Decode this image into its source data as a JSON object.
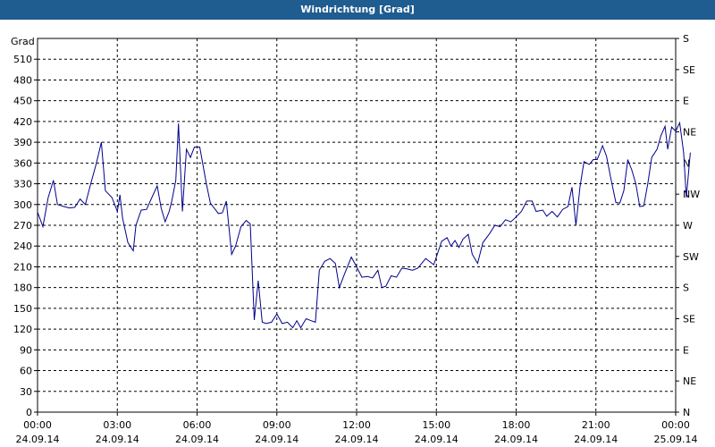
{
  "window": {
    "title": "Windrichtung [Grad]"
  },
  "chart_data": {
    "type": "line",
    "title": "Windrichtung [Grad]",
    "ylabel": "Grad",
    "xlabel": "",
    "ylim": [
      0,
      540
    ],
    "xlim_hours": [
      0,
      24
    ],
    "grid": true,
    "y_ticks": [
      0,
      30,
      60,
      90,
      120,
      150,
      180,
      210,
      240,
      270,
      300,
      330,
      360,
      390,
      420,
      450,
      480,
      510
    ],
    "y2_ticks": [
      {
        "value": 0,
        "label": "N"
      },
      {
        "value": 45,
        "label": "NE"
      },
      {
        "value": 90,
        "label": "E"
      },
      {
        "value": 135,
        "label": "SE"
      },
      {
        "value": 180,
        "label": "S"
      },
      {
        "value": 225,
        "label": "SW"
      },
      {
        "value": 270,
        "label": "W"
      },
      {
        "value": 315,
        "label": "NW"
      },
      {
        "value": 360,
        "label": "N"
      },
      {
        "value": 405,
        "label": "NE"
      },
      {
        "value": 450,
        "label": "E"
      },
      {
        "value": 495,
        "label": "SE"
      },
      {
        "value": 540,
        "label": "S"
      }
    ],
    "x_ticks": [
      {
        "hour": 0,
        "time": "00:00",
        "date": "24.09.14"
      },
      {
        "hour": 3,
        "time": "03:00",
        "date": "24.09.14"
      },
      {
        "hour": 6,
        "time": "06:00",
        "date": "24.09.14"
      },
      {
        "hour": 9,
        "time": "09:00",
        "date": "24.09.14"
      },
      {
        "hour": 12,
        "time": "12:00",
        "date": "24.09.14"
      },
      {
        "hour": 15,
        "time": "15:00",
        "date": "24.09.14"
      },
      {
        "hour": 18,
        "time": "18:00",
        "date": "24.09.14"
      },
      {
        "hour": 21,
        "time": "21:00",
        "date": "24.09.14"
      },
      {
        "hour": 24,
        "time": "00:00",
        "date": "25.09.14"
      }
    ],
    "series": [
      {
        "color": "#00008b",
        "points": [
          [
            0.0,
            289
          ],
          [
            0.2,
            268
          ],
          [
            0.4,
            310
          ],
          [
            0.6,
            335
          ],
          [
            0.75,
            300
          ],
          [
            1.0,
            297
          ],
          [
            1.2,
            295
          ],
          [
            1.4,
            296
          ],
          [
            1.6,
            308
          ],
          [
            1.8,
            300
          ],
          [
            2.0,
            330
          ],
          [
            2.2,
            358
          ],
          [
            2.4,
            390
          ],
          [
            2.55,
            320
          ],
          [
            2.8,
            310
          ],
          [
            3.0,
            290
          ],
          [
            3.1,
            314
          ],
          [
            3.2,
            280
          ],
          [
            3.4,
            245
          ],
          [
            3.6,
            233
          ],
          [
            3.7,
            270
          ],
          [
            3.9,
            292
          ],
          [
            4.1,
            293
          ],
          [
            4.3,
            310
          ],
          [
            4.5,
            327
          ],
          [
            4.65,
            295
          ],
          [
            4.8,
            275
          ],
          [
            4.95,
            290
          ],
          [
            5.05,
            305
          ],
          [
            5.2,
            335
          ],
          [
            5.3,
            417
          ],
          [
            5.45,
            290
          ],
          [
            5.6,
            380
          ],
          [
            5.75,
            368
          ],
          [
            5.9,
            383
          ],
          [
            6.1,
            383
          ],
          [
            6.35,
            330
          ],
          [
            6.5,
            302
          ],
          [
            6.8,
            287
          ],
          [
            6.95,
            288
          ],
          [
            7.1,
            305
          ],
          [
            7.3,
            228
          ],
          [
            7.45,
            240
          ],
          [
            7.65,
            268
          ],
          [
            7.85,
            277
          ],
          [
            8.0,
            272
          ],
          [
            8.15,
            133
          ],
          [
            8.3,
            190
          ],
          [
            8.45,
            130
          ],
          [
            8.6,
            128
          ],
          [
            8.8,
            130
          ],
          [
            9.0,
            142
          ],
          [
            9.2,
            128
          ],
          [
            9.4,
            130
          ],
          [
            9.6,
            122
          ],
          [
            9.75,
            132
          ],
          [
            9.9,
            122
          ],
          [
            10.1,
            135
          ],
          [
            10.3,
            132
          ],
          [
            10.45,
            130
          ],
          [
            10.6,
            205
          ],
          [
            10.8,
            218
          ],
          [
            11.0,
            222
          ],
          [
            11.2,
            215
          ],
          [
            11.35,
            180
          ],
          [
            11.55,
            200
          ],
          [
            11.8,
            224
          ],
          [
            12.0,
            210
          ],
          [
            12.2,
            195
          ],
          [
            12.4,
            196
          ],
          [
            12.6,
            194
          ],
          [
            12.8,
            205
          ],
          [
            12.95,
            180
          ],
          [
            13.1,
            182
          ],
          [
            13.3,
            197
          ],
          [
            13.5,
            195
          ],
          [
            13.7,
            208
          ],
          [
            13.9,
            207
          ],
          [
            14.1,
            205
          ],
          [
            14.3,
            208
          ],
          [
            14.6,
            222
          ],
          [
            14.9,
            213
          ],
          [
            15.2,
            247
          ],
          [
            15.4,
            252
          ],
          [
            15.55,
            240
          ],
          [
            15.7,
            248
          ],
          [
            15.85,
            238
          ],
          [
            16.0,
            250
          ],
          [
            16.2,
            257
          ],
          [
            16.35,
            228
          ],
          [
            16.55,
            215
          ],
          [
            16.75,
            245
          ],
          [
            17.0,
            258
          ],
          [
            17.2,
            270
          ],
          [
            17.4,
            268
          ],
          [
            17.6,
            278
          ],
          [
            17.8,
            275
          ],
          [
            18.0,
            282
          ],
          [
            18.2,
            290
          ],
          [
            18.4,
            305
          ],
          [
            18.6,
            305
          ],
          [
            18.75,
            290
          ],
          [
            19.0,
            292
          ],
          [
            19.15,
            283
          ],
          [
            19.35,
            290
          ],
          [
            19.55,
            282
          ],
          [
            19.75,
            293
          ],
          [
            19.95,
            297
          ],
          [
            20.1,
            325
          ],
          [
            20.25,
            270
          ],
          [
            20.4,
            325
          ],
          [
            20.55,
            362
          ],
          [
            20.75,
            358
          ],
          [
            20.9,
            365
          ],
          [
            21.05,
            365
          ],
          [
            21.25,
            385
          ],
          [
            21.4,
            370
          ],
          [
            21.55,
            340
          ],
          [
            21.75,
            303
          ],
          [
            21.9,
            302
          ],
          [
            22.05,
            320
          ],
          [
            22.2,
            365
          ],
          [
            22.35,
            350
          ],
          [
            22.5,
            330
          ],
          [
            22.65,
            297
          ],
          [
            22.8,
            298
          ],
          [
            22.95,
            330
          ],
          [
            23.1,
            368
          ],
          [
            23.3,
            380
          ],
          [
            23.45,
            400
          ],
          [
            23.6,
            413
          ],
          [
            23.7,
            380
          ],
          [
            23.85,
            412
          ],
          [
            24.0,
            406
          ],
          [
            24.15,
            418
          ],
          [
            24.3,
            375
          ],
          [
            24.4,
            310
          ],
          [
            24.55,
            375
          ]
        ]
      }
    ]
  }
}
